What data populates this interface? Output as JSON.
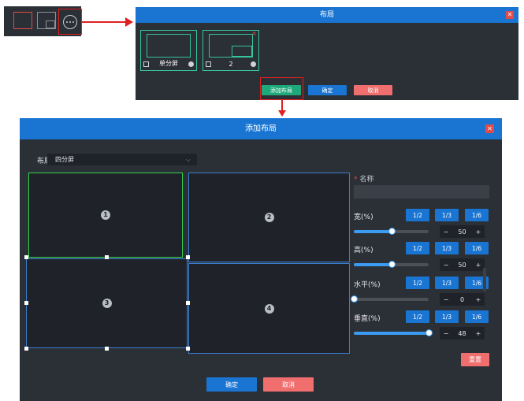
{
  "toolbar": {
    "items": [
      {
        "icon": "single-screen-icon"
      },
      {
        "icon": "pip-layout-icon"
      },
      {
        "icon": "more-icon"
      }
    ]
  },
  "layout_dialog": {
    "title": "布局",
    "cards": [
      {
        "label": "单分屏"
      },
      {
        "label": "2"
      }
    ],
    "add_button": "添加布局",
    "confirm_button": "确定",
    "cancel_button": "取消"
  },
  "add_dialog": {
    "title": "添加布局",
    "layout_label": "布局",
    "layout_value": "四分屏",
    "panes": [
      "1",
      "2",
      "3",
      "4"
    ],
    "name_label": "名称",
    "name_required_mark": "*",
    "name_value": "",
    "props": [
      {
        "label": "宽(%)",
        "fractions": [
          "1/2",
          "1/3",
          "1/6"
        ],
        "value": "50",
        "percent": 50
      },
      {
        "label": "高(%)",
        "fractions": [
          "1/2",
          "1/3",
          "1/6"
        ],
        "value": "50",
        "percent": 50
      },
      {
        "label": "水平(%)",
        "fractions": [
          "1/2",
          "1/3",
          "1/6"
        ],
        "value": "0",
        "percent": 0
      },
      {
        "label": "垂直(%)",
        "fractions": [
          "1/2",
          "1/3",
          "1/6"
        ],
        "value": "48",
        "percent": 100
      }
    ],
    "minus": "−",
    "plus": "+",
    "reset_button": "重置",
    "confirm_button": "确定",
    "cancel_button": "取消"
  },
  "colors": {
    "accent_blue": "#1a75d2",
    "accent_green": "#1fa87a",
    "danger_red": "#f06e6e",
    "selection_green": "#33d452"
  }
}
